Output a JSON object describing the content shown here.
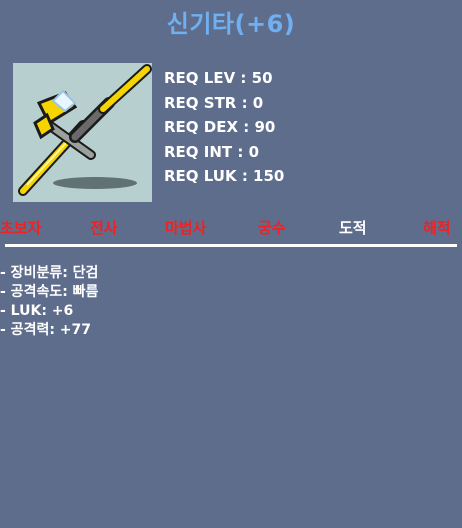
{
  "item": {
    "name": "신기타(+6)",
    "icon": "guitar-dagger-icon",
    "requirements": [
      "REQ LEV : 50",
      "REQ STR : 0",
      "REQ DEX : 90",
      "REQ INT : 0",
      "REQ LUK : 150"
    ]
  },
  "jobs": [
    {
      "label": "초보자",
      "eligible": false
    },
    {
      "label": "전사",
      "eligible": false
    },
    {
      "label": "마법사",
      "eligible": false
    },
    {
      "label": "궁수",
      "eligible": false
    },
    {
      "label": "도적",
      "eligible": true
    },
    {
      "label": "해적",
      "eligible": false
    }
  ],
  "stats": [
    "- 장비분류: 단검",
    "- 공격속도: 빠름",
    "- LUK: +6",
    "- 공격력: +77"
  ],
  "colors": {
    "background": "#5f6d8d",
    "title": "#6fb0f2",
    "job_ineligible": "#ee2222",
    "job_eligible": "#ffffff",
    "icon_bg": "#b7cfcf"
  }
}
